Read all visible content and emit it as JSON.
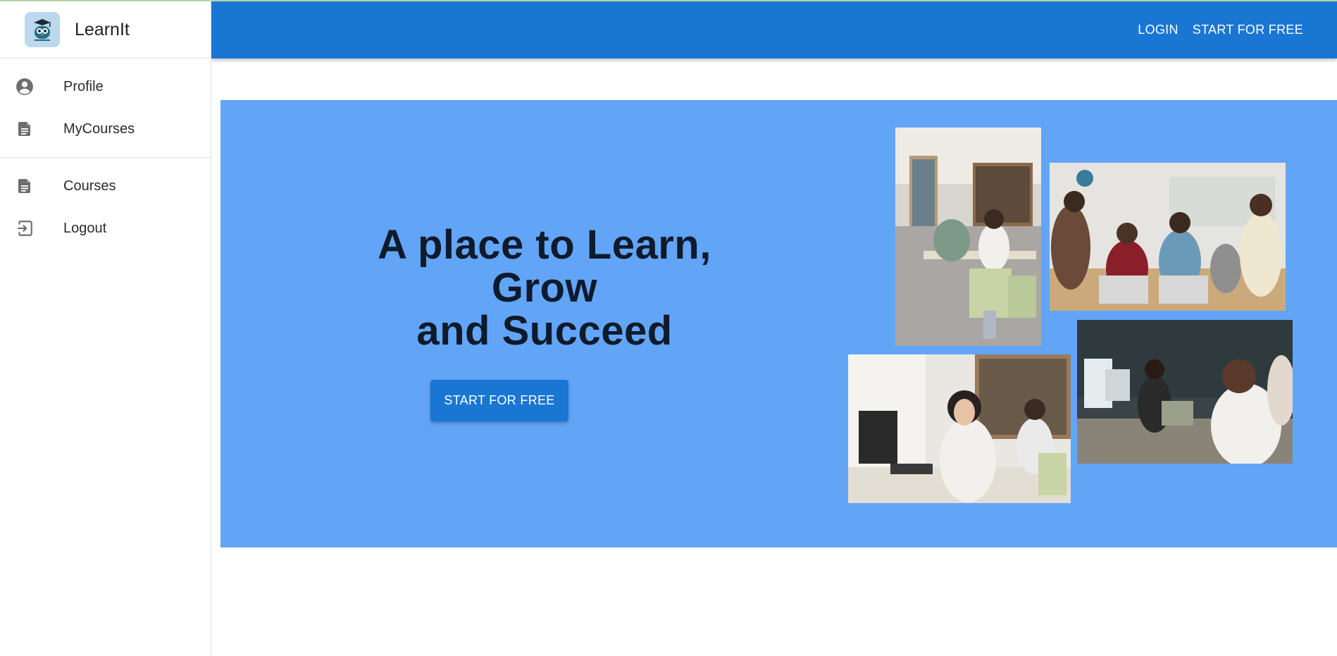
{
  "app": {
    "brand_name": "LearnIt",
    "logo_icon": "owl-graduation-cap-logo"
  },
  "topbar": {
    "login_label": "LOGIN",
    "start_label": "START FOR FREE",
    "color": "#1a76d3"
  },
  "sidebar": {
    "groups": [
      {
        "items": [
          {
            "label": "Profile",
            "icon": "account-circle-icon"
          },
          {
            "label": "MyCourses",
            "icon": "document-icon"
          }
        ]
      },
      {
        "items": [
          {
            "label": "Courses",
            "icon": "document-icon"
          },
          {
            "label": "Logout",
            "icon": "logout-icon"
          }
        ]
      }
    ]
  },
  "hero": {
    "title_line1": "A place to Learn,",
    "title_line2": "Grow",
    "title_line3": "and Succeed",
    "cta_label": "START FOR FREE",
    "background": "#62a5f7",
    "images": [
      {
        "name": "library-students-photo"
      },
      {
        "name": "classroom-raised-hands-photo"
      },
      {
        "name": "computer-lab-student-photo"
      },
      {
        "name": "group-study-laptop-photo"
      }
    ]
  }
}
